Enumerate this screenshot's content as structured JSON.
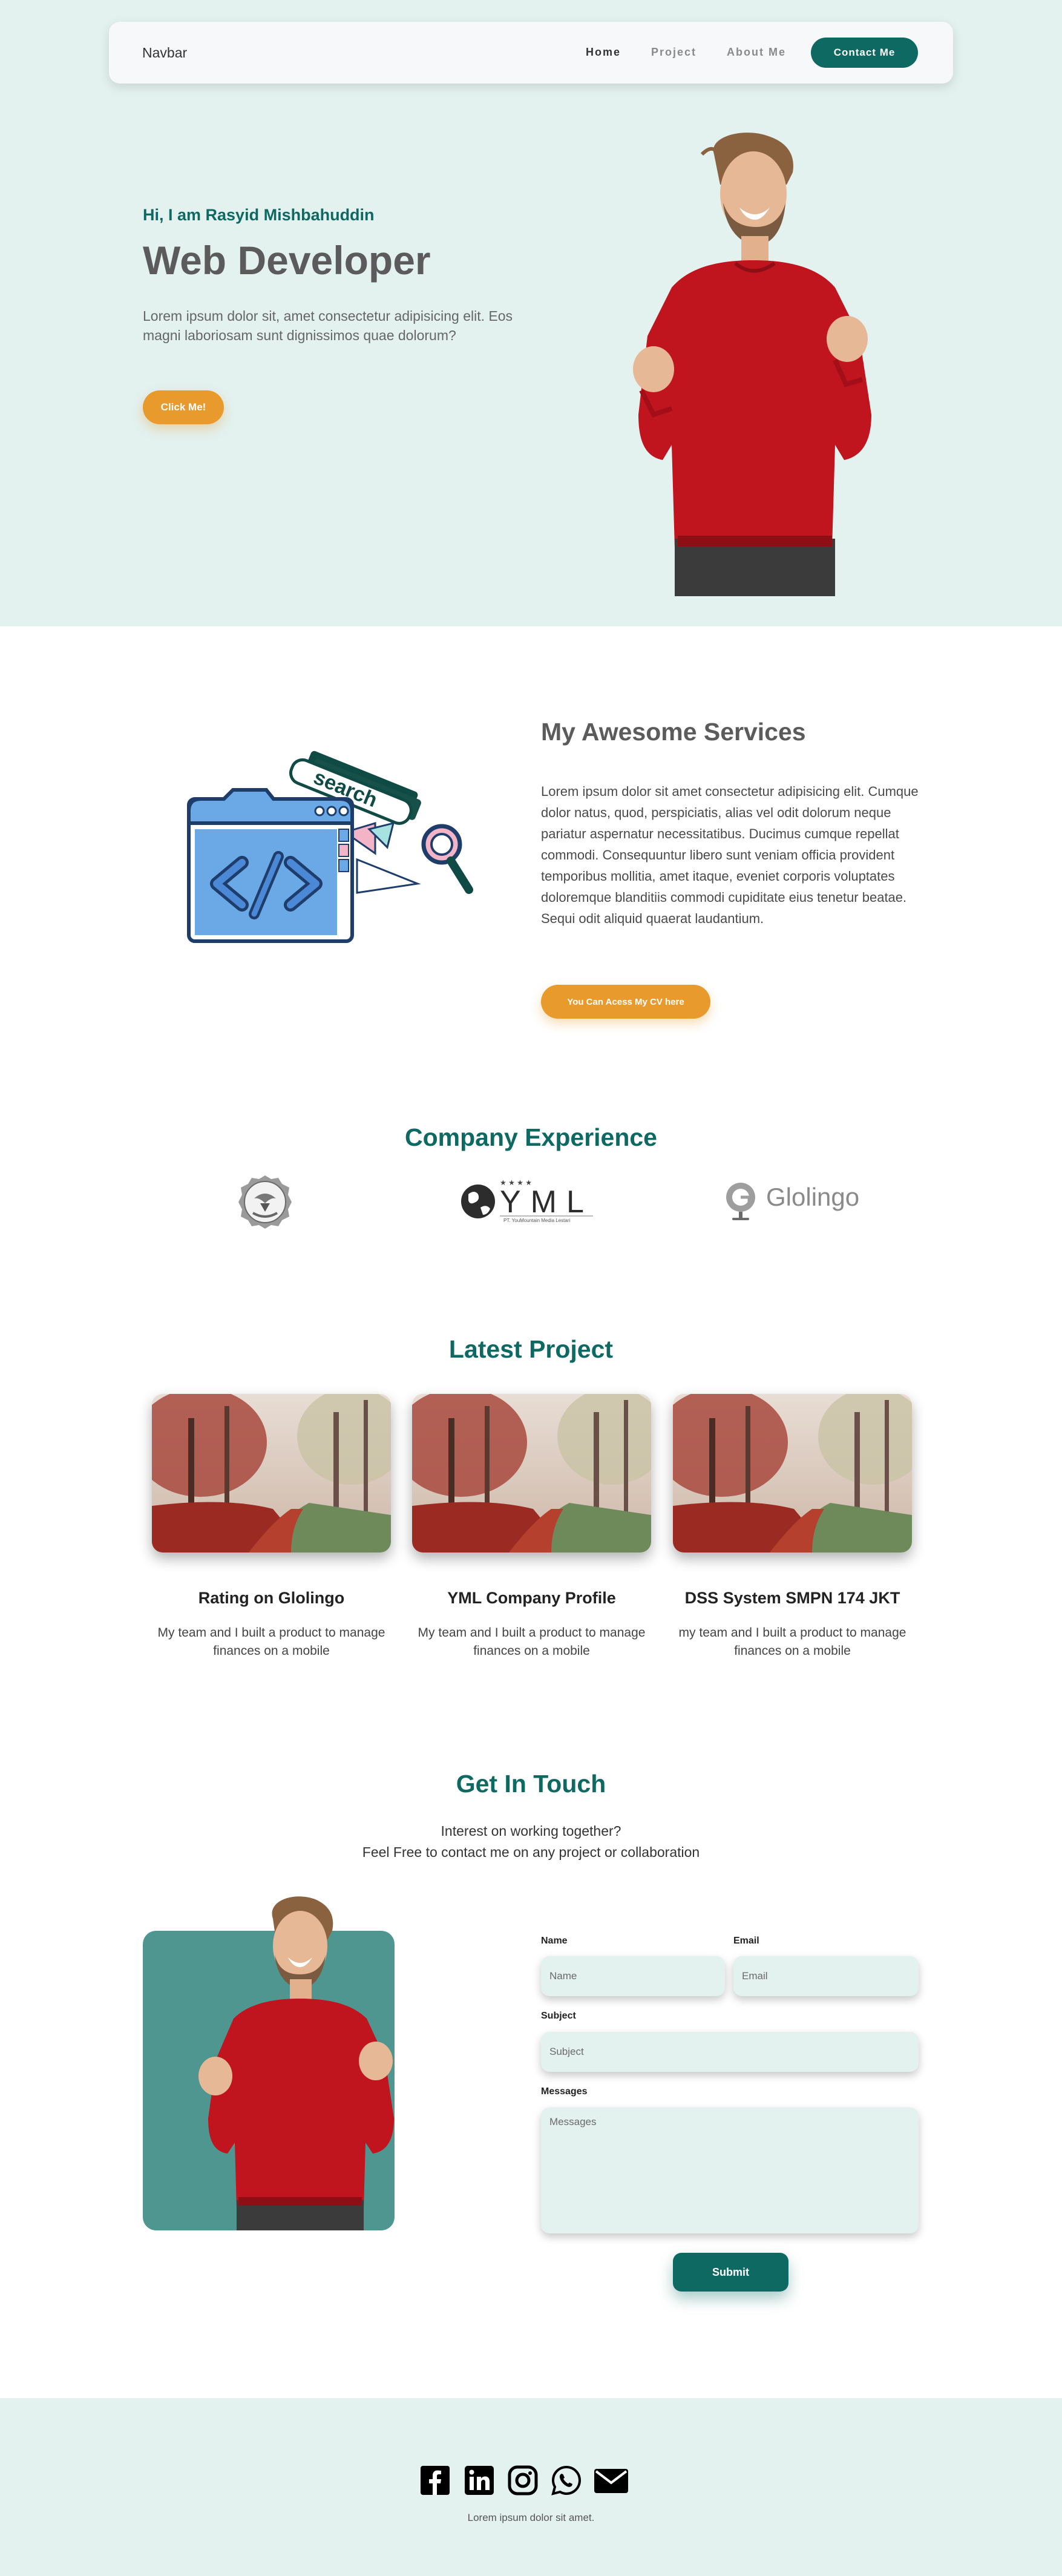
{
  "nav": {
    "brand": "Navbar",
    "links": [
      "Home",
      "Project",
      "About Me"
    ],
    "contact_label": "Contact Me"
  },
  "hero": {
    "greeting": "Hi, I am Rasyid Mishbahuddin",
    "title": "Web Developer",
    "description": "Lorem ipsum dolor sit, amet consectetur adipisicing elit. Eos magni laboriosam sunt dignissimos quae dolorum?",
    "button": "Click Me!"
  },
  "services": {
    "title": "My Awesome Services",
    "text": "Lorem ipsum dolor sit amet consectetur adipisicing elit. Cumque dolor natus, quod, perspiciatis, alias vel odit dolorum neque pariatur aspernatur necessitatibus. Ducimus cumque repellat commodi. Consequuntur libero sunt veniam officia provident temporibus mollitia, amet itaque, eveniet corporis voluptates doloremque blanditiis commodi cupiditate eius tenetur beatae. Sequi odit aliquid quaerat laudantium.",
    "button": "You Can Acess My CV here",
    "illustration_word": "search"
  },
  "company": {
    "title": "Company Experience",
    "yml_text": "YML",
    "yml_subtext": "PT. YouMountain Media Lestari",
    "glolingo_text": "Glolingo"
  },
  "projects": {
    "title": "Latest Project",
    "items": [
      {
        "title": "Rating on Glolingo",
        "desc": "My team and I built a product to manage finances on a mobile"
      },
      {
        "title": "YML Company Profile",
        "desc": "My team and I built a product to manage finances on a mobile"
      },
      {
        "title": "DSS System SMPN 174 JKT",
        "desc": "my team and I built a product to manage finances on a mobile"
      }
    ]
  },
  "contact": {
    "title": "Get In Touch",
    "line1": "Interest on working together?",
    "line2": "Feel Free to contact me on any project or collaboration",
    "name_label": "Name",
    "name_placeholder": "Name",
    "email_label": "Email",
    "email_placeholder": "Email",
    "subject_label": "Subject",
    "subject_placeholder": "Subject",
    "messages_label": "Messages",
    "messages_placeholder": "Messages",
    "submit": "Submit"
  },
  "footer": {
    "icons": [
      "facebook-icon",
      "linkedin-icon",
      "instagram-icon",
      "whatsapp-icon",
      "mail-icon"
    ],
    "text": "Lorem ipsum dolor sit amet."
  },
  "colors": {
    "primary": "#0e6963",
    "accent": "#e89a2c",
    "hero_bg": "#e3f1ef",
    "photo_bg": "#4f9690",
    "shirt": "#c0141e"
  }
}
